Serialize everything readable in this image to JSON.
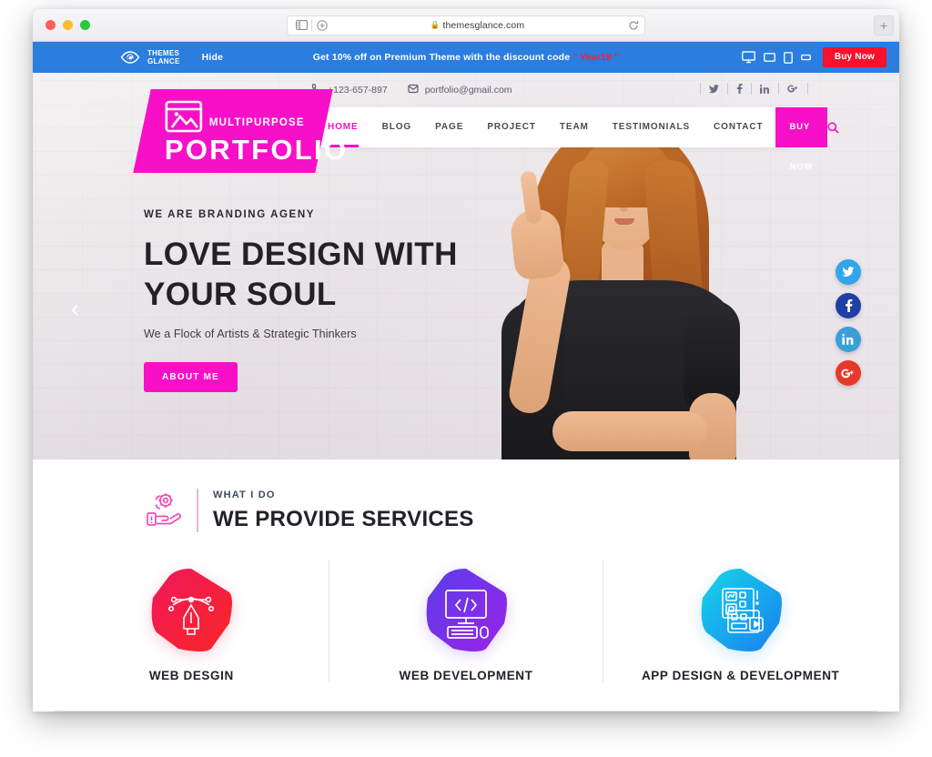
{
  "browser": {
    "url": "themesglance.com",
    "lock_icon": "lock-icon",
    "sidebar_icon": "sidebar-toggle-icon",
    "newtab_small_icon": "new-tab-small-icon",
    "reload_icon": "reload-icon",
    "newtab_icon": "new-tab-icon",
    "traffic_lights": [
      "close",
      "minimize",
      "zoom"
    ]
  },
  "themesglance_bar": {
    "brand_line1": "THEMES",
    "brand_line2": "GLANCE",
    "logo_icon": "themesglance-eye-logo",
    "hide_label": "Hide",
    "promo_prefix": "Get 10% off on Premium Theme with the discount code",
    "promo_code": "\" Year19 \"",
    "devices": [
      "desktop-icon",
      "tablet-landscape-icon",
      "tablet-portrait-icon",
      "mobile-icon"
    ],
    "buy_now_label": "Buy Now",
    "bar_color": "#2b7ddf",
    "buy_now_color": "#f8112b"
  },
  "site_header": {
    "logo": {
      "icon": "image-placeholder-icon",
      "kicker": "MULTIPURPOSE",
      "title": "PORTFOLIO",
      "color": "#f710c8"
    },
    "contact": {
      "phone_icon": "phone-icon",
      "phone": "+123-657-897",
      "email_icon": "envelope-icon",
      "email": "portfolio@gmail.com"
    },
    "social_top": [
      {
        "name": "twitter-icon",
        "glyph": "🐦"
      },
      {
        "name": "facebook-icon",
        "glyph": "f"
      },
      {
        "name": "linkedin-icon",
        "glyph": "in"
      },
      {
        "name": "googleplus-icon",
        "glyph": "G+"
      }
    ],
    "nav": [
      {
        "label": "HOME",
        "active": true
      },
      {
        "label": "BLOG",
        "active": false
      },
      {
        "label": "PAGE",
        "active": false
      },
      {
        "label": "PROJECT",
        "active": false
      },
      {
        "label": "TEAM",
        "active": false
      },
      {
        "label": "TESTIMONIALS",
        "active": false
      },
      {
        "label": "CONTACT",
        "active": false
      }
    ],
    "nav_buy_label": "BUY NOW",
    "search_icon": "search-icon"
  },
  "hero": {
    "eyebrow": "WE ARE BRANDING AGENY",
    "title_line1": "LOVE DESIGN WITH",
    "title_line2": "YOUR SOUL",
    "subtitle": "We a Flock of Artists & Strategic Thinkers",
    "button_label": "ABOUT ME",
    "prev_arrow": "‹",
    "next_arrow": "›",
    "social_rail": [
      {
        "name": "twitter-icon",
        "glyph": "🐦",
        "color": "#30a7ec"
      },
      {
        "name": "facebook-icon",
        "glyph": "f",
        "color": "#1f3fa5"
      },
      {
        "name": "linkedin-icon",
        "glyph": "in",
        "color": "#3b9fd6"
      },
      {
        "name": "googleplus-icon",
        "glyph": "G+",
        "color": "#e8382c"
      }
    ]
  },
  "services": {
    "icon": "hand-gear-support-icon",
    "kicker": "WHAT I DO",
    "heading": "WE PROVIDE SERVICES",
    "cards": [
      {
        "title": "WEB DESGIN",
        "icon": "pen-tool-icon",
        "color_from": "#f0185c",
        "color_to": "#fa2626"
      },
      {
        "title": "WEB DEVELOPMENT",
        "icon": "monitor-code-icon",
        "color_from": "#5a3ee8",
        "color_to": "#9b23e8"
      },
      {
        "title": "APP DESIGN & DEVELOPMENT",
        "icon": "app-layout-icon",
        "color_from": "#16d6e8",
        "color_to": "#1a7ef0"
      }
    ]
  }
}
